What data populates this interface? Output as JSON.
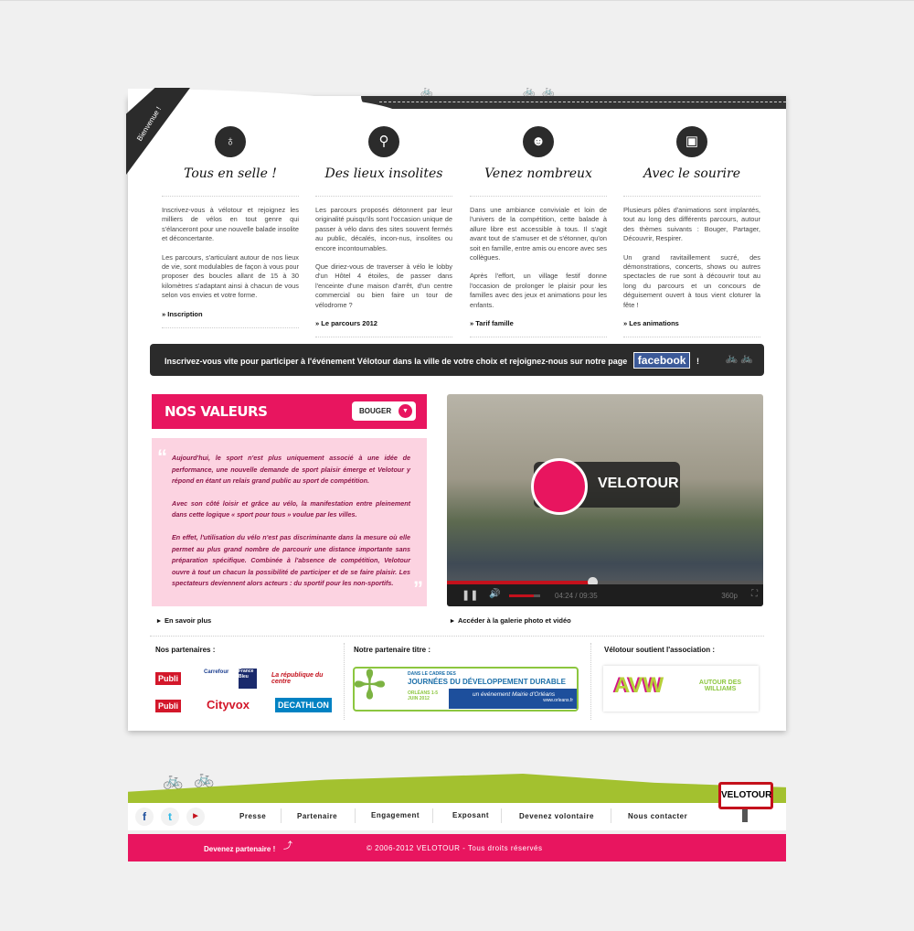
{
  "ribbon": "Bienvenue !",
  "columns": [
    {
      "icon": "bicycle-icon",
      "glyph": "♁",
      "title": "Tous en selle !",
      "paragraphs": [
        "Inscrivez-vous à vélotour et rejoignez les milliers de vélos en tout genre qui s'élanceront pour une nouvelle balade insolite et déconcertante.",
        "Les parcours, s'articulant autour de nos lieux de vie, sont modulables de façon à vous pour proposer des boucles allant de 15 à 30 kilomètres s'adaptant ainsi à chacun de vous selon vos envies et votre forme."
      ],
      "link": "» Inscription"
    },
    {
      "icon": "map-pin-icon",
      "glyph": "⚲",
      "title": "Des lieux insolites",
      "paragraphs": [
        "Les parcours proposés détonnent par leur originalité puisqu'ils sont l'occasion unique de passer à vélo dans des sites souvent fermés au public, décalés, incon-nus, insolites ou encore incontournables.",
        "Que diriez-vous de traverser à vélo le lobby d'un Hôtel 4 étoiles, de passer dans l'enceinte d'une maison d'arrêt, d'un centre commercial ou bien faire un tour de vélodrome ?"
      ],
      "link": "» Le parcours 2012"
    },
    {
      "icon": "group-icon",
      "glyph": "☻",
      "title": "Venez nombreux",
      "paragraphs": [
        "Dans une ambiance conviviale et loin de l'univers de la compétition, cette balade à allure libre est accessible à tous. Il s'agit avant tout de s'amuser et de s'étonner, qu'on soit en famille, entre amis ou encore avec ses collègues.",
        "Après l'effort, un village festif donne l'occasion de prolonger le plaisir pour les familles avec des jeux et animations pour les enfants."
      ],
      "link": "» Tarif famille"
    },
    {
      "icon": "shop-icon",
      "glyph": "▣",
      "title": "Avec le sourire",
      "paragraphs": [
        "Plusieurs pôles d'animations sont implantés, tout au long des différents parcours, autour des thèmes suivants : Bouger, Partager, Découvrir, Respirer.",
        "Un grand ravitaillement sucré, des démonstrations, concerts, shows ou autres spectacles de rue sont à découvrir tout au long du parcours et un concours de déguisement ouvert à tous vient cloturer la fête !"
      ],
      "link": "» Les animations"
    }
  ],
  "banner": {
    "text": "Inscrivez-vous vite pour participer à l'événement Vélotour dans la ville de votre choix et rejoignez-nous sur notre page",
    "facebook": "facebook",
    "end": "!"
  },
  "valeurs": {
    "title": "NOS VALEURS",
    "select": "BOUGER",
    "paragraphs": [
      "Aujourd'hui, le sport n'est plus uniquement associé à une idée de performance, une nouvelle demande de sport plaisir émerge et Velotour y répond en étant un relais grand public au sport de compétition.",
      "Avec son côté loisir et grâce au vélo, la manifestation entre pleinement dans cette logique « sport pour tous » voulue par les villes.",
      "En effet, l'utilisation du vélo n'est pas discriminante dans la mesure où elle permet au plus grand nombre de parcourir une distance importante sans préparation spécifique. Combinée à l'absence de compétition, Velotour ouvre à tout un chacun la possibilité de participer et de se faire plaisir. Les spectateurs deviennent alors acteurs : du sportif pour les non-sportifs."
    ],
    "link": "En savoir plus"
  },
  "video": {
    "logo": "VELOTOUR",
    "time": "04:24 / 09:35",
    "progress": 0.46,
    "volume": 0.8,
    "quality": "360p",
    "link": "Accéder à la galerie photo et vidéo"
  },
  "partners": {
    "title": "Nos partenaires :",
    "logos": [
      "Publi",
      "Carrefour",
      "France Bleu",
      "La république du centre",
      "Publi",
      "Cityvox",
      "DECATHLON"
    ],
    "title_partner": "Notre partenaire titre :",
    "title_partner_text": [
      "DANS LE CADRE DES",
      "JOURNÉES DU DÉVELOPPEMENT DURABLE",
      "ORLÉANS 1-5 JUIN 2012",
      "un événement Mairie d'Orléans",
      "www.orleans.fr"
    ],
    "assoc_title": "Vélotour soutient l'association :",
    "assoc": [
      "AVW",
      "AUTOUR DES WILLIAMS"
    ]
  },
  "nav": {
    "items": [
      "Presse",
      "Partenaire",
      "Engagement",
      "Exposant",
      "Devenez volontaire",
      "Nous contacter"
    ],
    "sign": "VELOTOUR"
  },
  "footer": {
    "cta": "Devenez partenaire !",
    "copyright": "© 2006-2012 VELOTOUR - Tous droits réservés"
  },
  "colors": {
    "pink": "#e8155f",
    "dark": "#2b2b2b",
    "green": "#a3c12f"
  }
}
